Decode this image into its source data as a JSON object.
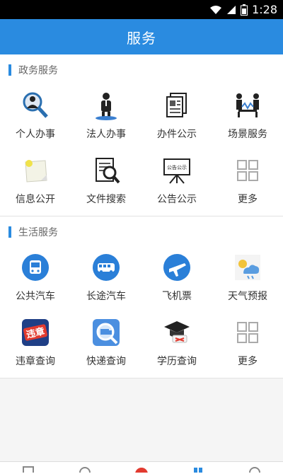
{
  "status_bar": {
    "time": "1:28"
  },
  "header": {
    "title": "服务"
  },
  "gov_section": {
    "title": "政务服务",
    "items": [
      {
        "label": "个人办事"
      },
      {
        "label": "法人办事"
      },
      {
        "label": "办件公示"
      },
      {
        "label": "场景服务"
      },
      {
        "label": "信息公开"
      },
      {
        "label": "文件搜索"
      },
      {
        "label": "公告公示",
        "sign_text": "公告公示"
      },
      {
        "label": "更多"
      }
    ]
  },
  "life_section": {
    "title": "生活服务",
    "items": [
      {
        "label": "公共汽车"
      },
      {
        "label": "长途汽车"
      },
      {
        "label": "飞机票"
      },
      {
        "label": "天气预报"
      },
      {
        "label": "违章查询",
        "badge_text": "违章"
      },
      {
        "label": "快递查询"
      },
      {
        "label": "学历查询"
      },
      {
        "label": "更多"
      }
    ]
  },
  "colors": {
    "accent": "#2a8be0",
    "background": "#f5f5f5",
    "text": "#333333",
    "section_title": "#666666"
  }
}
